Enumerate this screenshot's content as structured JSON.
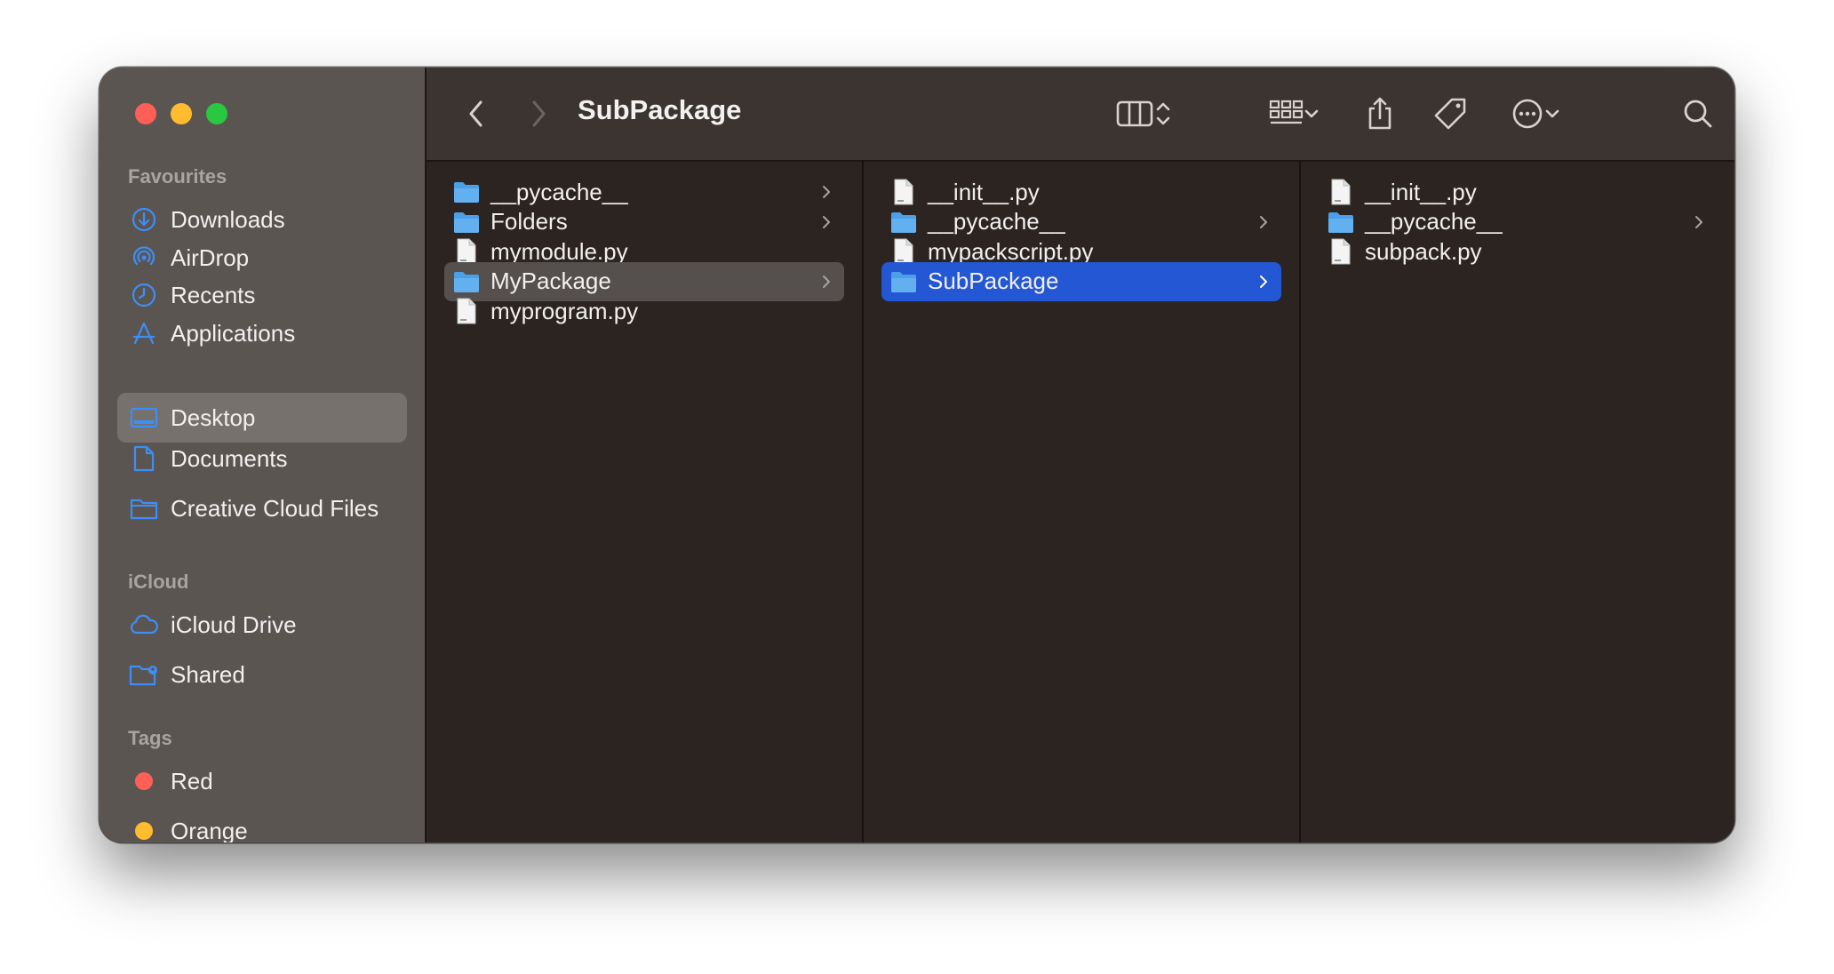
{
  "window": {
    "title": "SubPackage"
  },
  "sidebar": {
    "favourites_header": "Favourites",
    "favourites": [
      {
        "label": "Downloads",
        "icon": "downloads-icon"
      },
      {
        "label": "AirDrop",
        "icon": "airdrop-icon"
      },
      {
        "label": "Recents",
        "icon": "recents-icon"
      },
      {
        "label": "Applications",
        "icon": "applications-icon"
      },
      {
        "label": "Desktop",
        "icon": "desktop-icon",
        "selected": true
      },
      {
        "label": "Documents",
        "icon": "documents-icon"
      },
      {
        "label": "Creative Cloud Files",
        "icon": "folder-icon"
      }
    ],
    "icloud_header": "iCloud",
    "icloud": [
      {
        "label": "iCloud Drive",
        "icon": "cloud-icon"
      },
      {
        "label": "Shared",
        "icon": "shared-folder-icon"
      }
    ],
    "tags_header": "Tags",
    "tags": [
      {
        "label": "Red",
        "color": "#ff5f57"
      },
      {
        "label": "Orange",
        "color": "#febc2e"
      }
    ]
  },
  "columns": [
    [
      {
        "label": "__pycache__",
        "type": "folder"
      },
      {
        "label": "Folders",
        "type": "folder"
      },
      {
        "label": "mymodule.py",
        "type": "file"
      },
      {
        "label": "MyPackage",
        "type": "folder",
        "state": "selected-inactive"
      },
      {
        "label": "myprogram.py",
        "type": "file"
      }
    ],
    [
      {
        "label": "__init__.py",
        "type": "file"
      },
      {
        "label": "__pycache__",
        "type": "folder"
      },
      {
        "label": "mypackscript.py",
        "type": "file"
      },
      {
        "label": "SubPackage",
        "type": "folder",
        "state": "selected-active"
      }
    ],
    [
      {
        "label": "__init__.py",
        "type": "file"
      },
      {
        "label": "__pycache__",
        "type": "folder"
      },
      {
        "label": "subpack.py",
        "type": "file"
      }
    ]
  ],
  "colors": {
    "accent_blue": "#2357d3",
    "sidebar_icon_blue": "#3d8ef7",
    "folder_blue": "#63b0f1"
  }
}
